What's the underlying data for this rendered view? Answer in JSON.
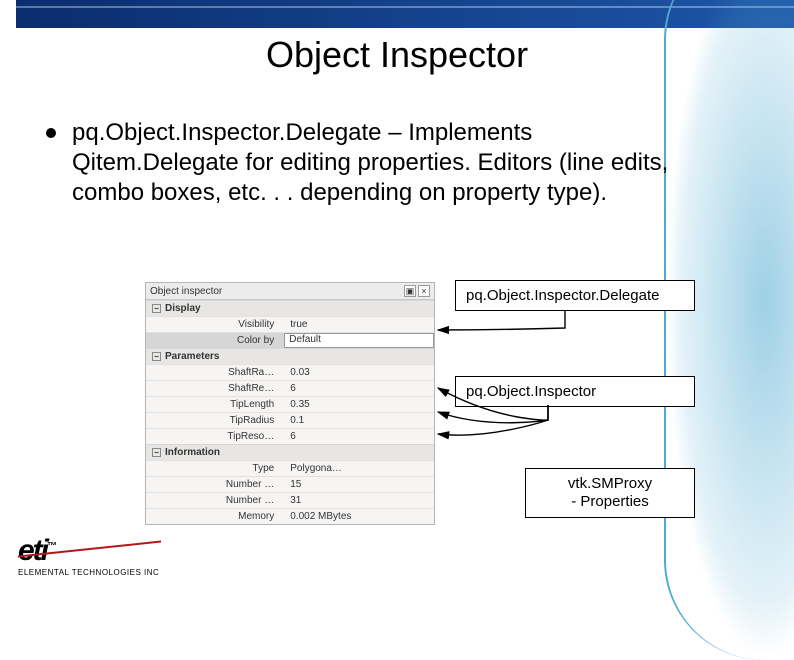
{
  "title": "Object Inspector",
  "bullet": "pq.Object.Inspector.Delegate – Implements Qitem.Delegate for editing properties.  Editors (line edits, combo boxes, etc. . . depending on property type).",
  "inspector": {
    "panel_title": "Object inspector",
    "sections": [
      {
        "name": "Display",
        "rows": [
          {
            "key": "Visibility",
            "value": "true"
          },
          {
            "key": "Color by",
            "value": "Default",
            "highlight": true
          }
        ]
      },
      {
        "name": "Parameters",
        "rows": [
          {
            "key": "ShaftRa…",
            "value": "0.03"
          },
          {
            "key": "ShaftRe…",
            "value": "6"
          },
          {
            "key": "TipLength",
            "value": "0.35"
          },
          {
            "key": "TipRadius",
            "value": "0.1"
          },
          {
            "key": "TipReso…",
            "value": "6"
          }
        ]
      },
      {
        "name": "Information",
        "rows": [
          {
            "key": "Type",
            "value": "Polygona…"
          },
          {
            "key": "Number …",
            "value": "15"
          },
          {
            "key": "Number …",
            "value": "31"
          },
          {
            "key": "Memory",
            "value": "0.002 MBytes"
          }
        ]
      }
    ]
  },
  "boxes": {
    "delegate": "pq.Object.Inspector.Delegate",
    "inspector": "pq.Object.Inspector",
    "proxy_line1": "vtk.SMProxy",
    "proxy_line2": "- Properties"
  },
  "logo": {
    "mark": "eti",
    "tm": "™",
    "sub": "ELEMENTAL TECHNOLOGIES INC"
  }
}
